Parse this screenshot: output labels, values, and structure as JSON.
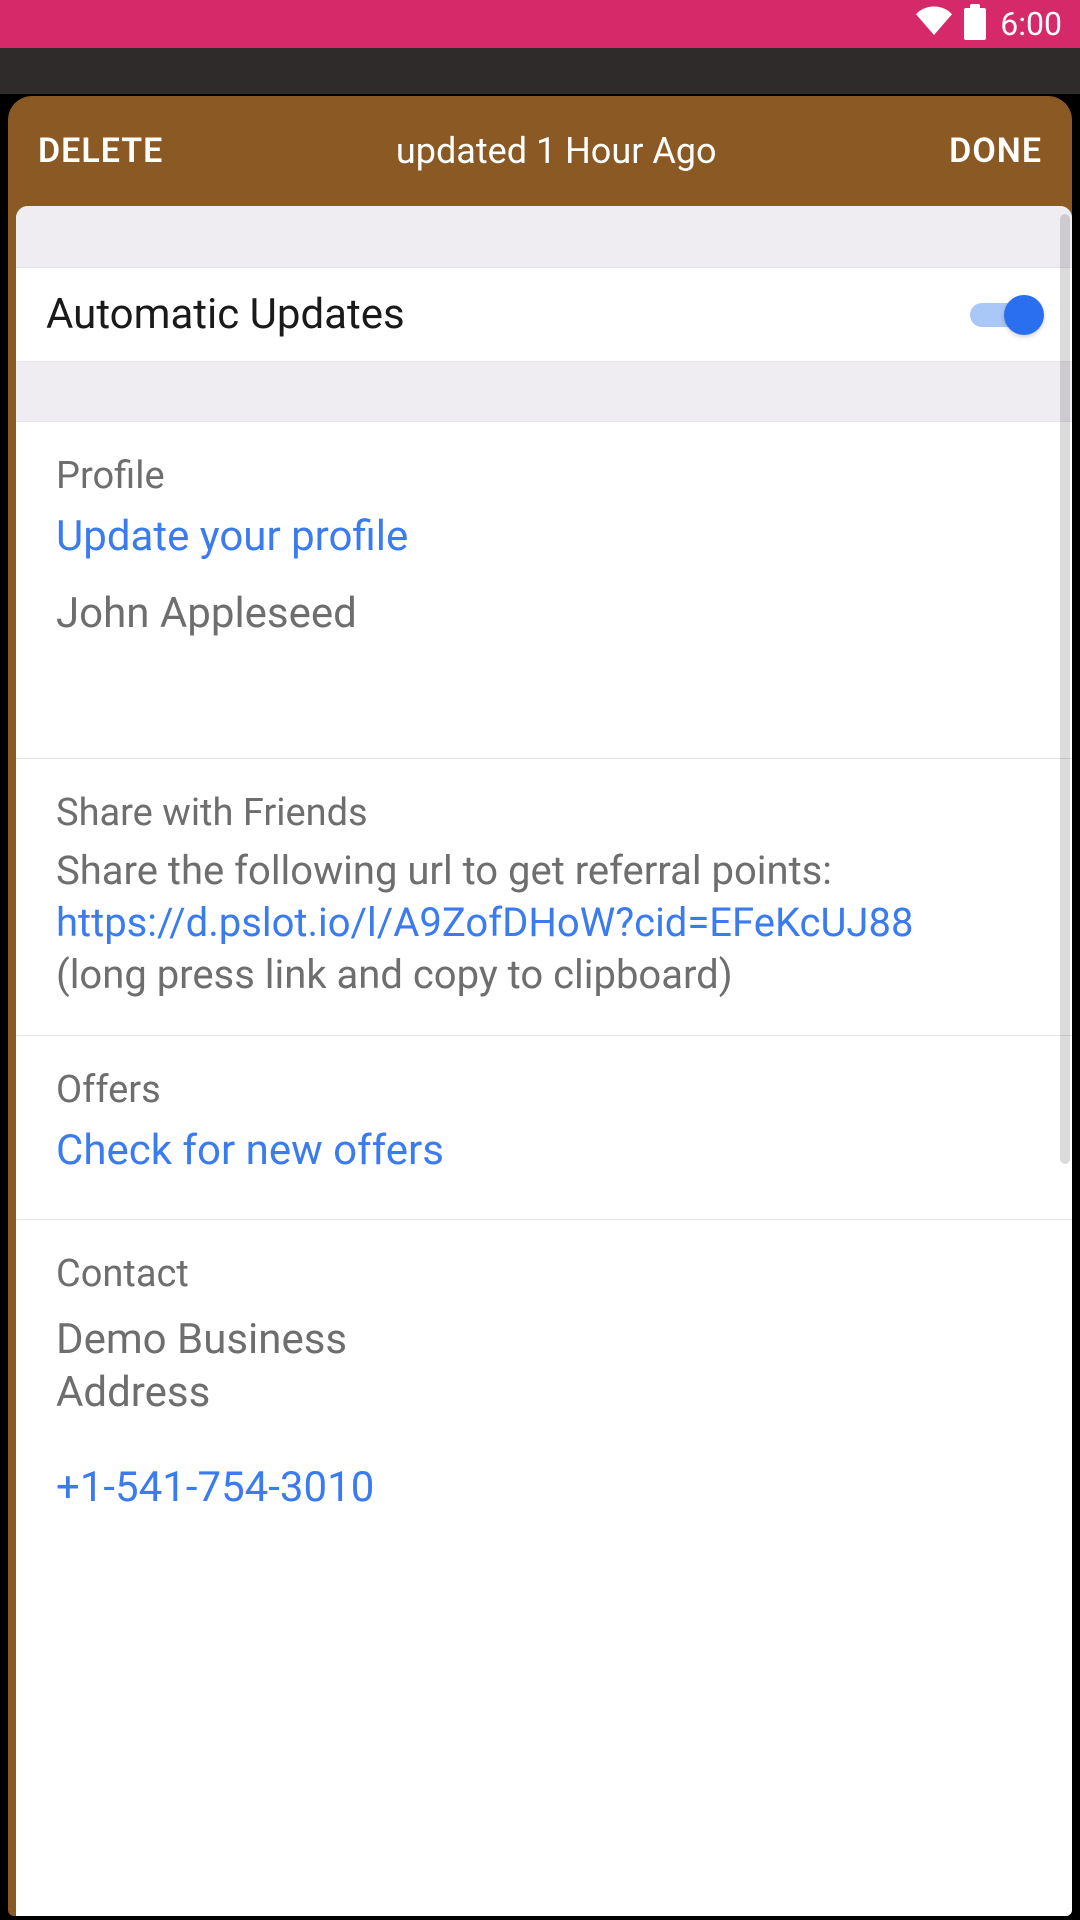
{
  "status": {
    "time": "6:00"
  },
  "header": {
    "delete": "DELETE",
    "title": "updated 1 Hour Ago",
    "done": "DONE"
  },
  "toggle": {
    "label": "Automatic Updates",
    "on": true
  },
  "profile": {
    "title": "Profile",
    "link": "Update your profile",
    "name": "John Appleseed"
  },
  "share": {
    "title": "Share with Friends",
    "lead": "Share the following url to get referral points:",
    "url": "https://d.pslot.io/l/A9ZofDHoW?cid=EFeKcUJ88",
    "hint": "(long press link and copy to clipboard)"
  },
  "offers": {
    "title": "Offers",
    "link": "Check for new offers"
  },
  "contact": {
    "title": "Contact",
    "line1": "Demo Business",
    "line2": "Address",
    "phone": "+1-541-754-3010"
  }
}
